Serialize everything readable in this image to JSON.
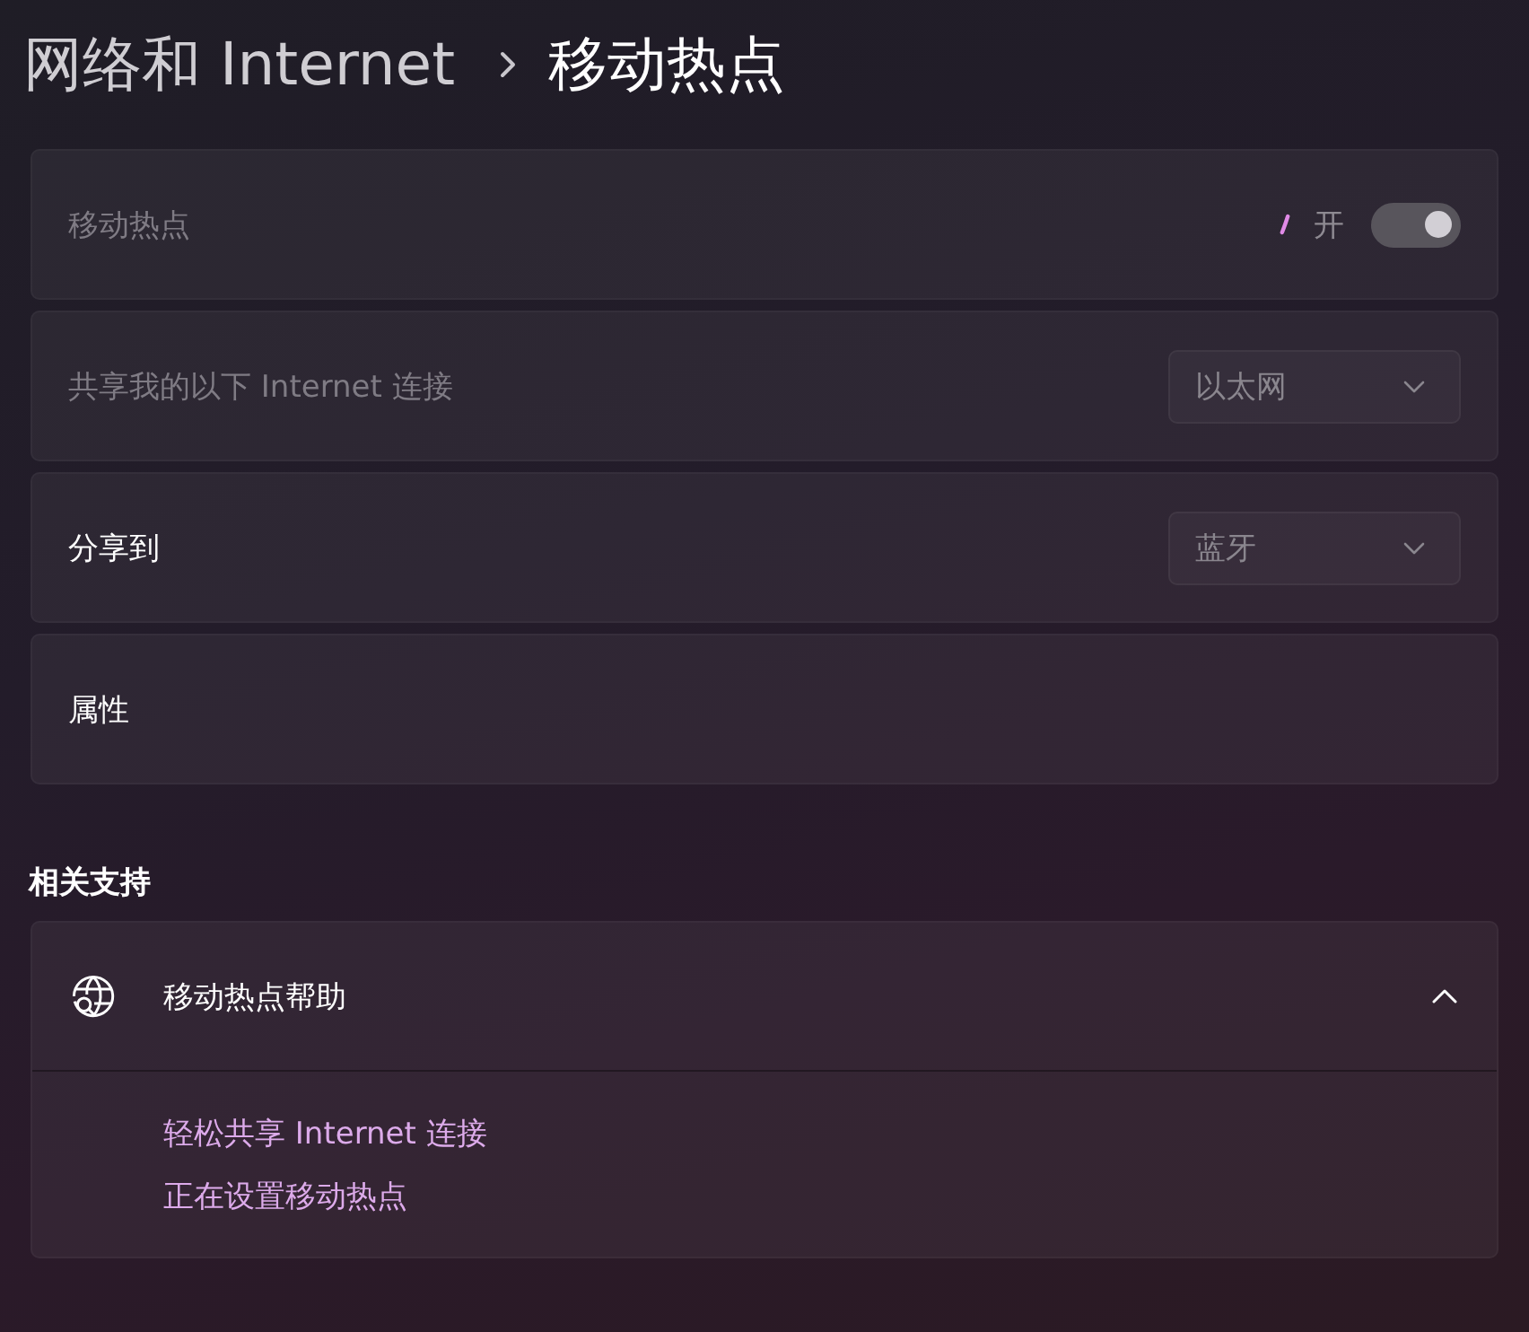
{
  "breadcrumb": {
    "parent": "网络和 Internet",
    "current": "移动热点"
  },
  "settings": [
    {
      "kind": "toggle",
      "label": "移动热点",
      "disabled": true,
      "toggle": {
        "busy": true,
        "state_text": "开",
        "on": true,
        "disabled": true
      }
    },
    {
      "kind": "dropdown",
      "label": "共享我的以下 Internet 连接",
      "disabled": true,
      "dropdown": {
        "value": "以太网",
        "disabled": true
      }
    },
    {
      "kind": "dropdown",
      "label": "分享到",
      "disabled": false,
      "dropdown": {
        "value": "蓝牙",
        "disabled": true
      }
    },
    {
      "kind": "label",
      "label": "属性",
      "disabled": false
    }
  ],
  "related": {
    "heading": "相关支持",
    "expander": {
      "title": "移动热点帮助",
      "expanded": true,
      "links": [
        "轻松共享 Internet 连接",
        "正在设置移动热点"
      ]
    }
  }
}
